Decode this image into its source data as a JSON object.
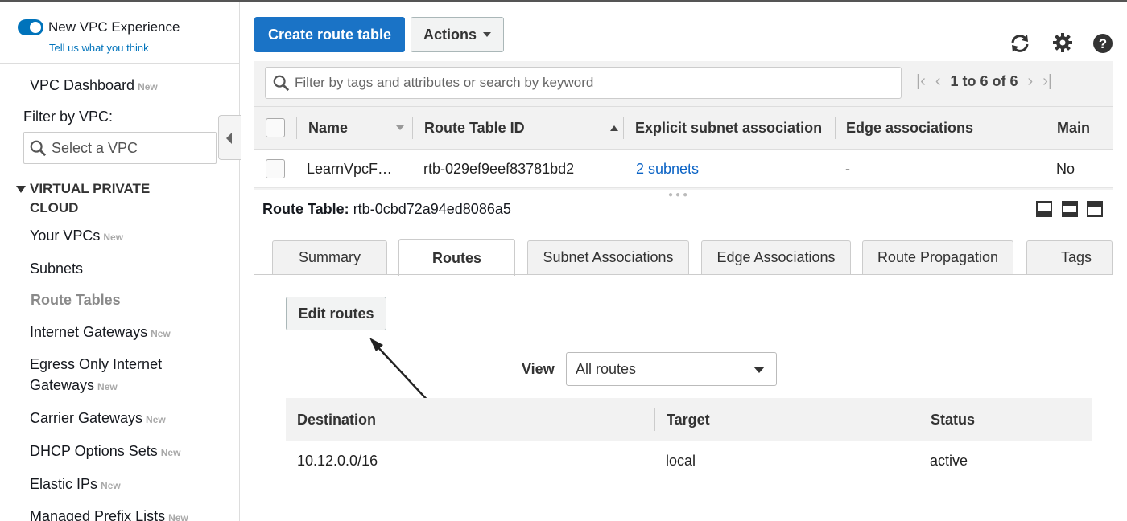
{
  "sidebar": {
    "toggle_label": "New VPC Experience",
    "tell_us": "Tell us what you think",
    "dashboard": "VPC Dashboard",
    "new_badge": "New",
    "filter_label": "Filter by VPC:",
    "select_placeholder": "Select a VPC",
    "section": {
      "line1": "VIRTUAL PRIVATE",
      "line2": "CLOUD"
    },
    "items": [
      {
        "label": "Your VPCs",
        "badge": "New"
      },
      {
        "label": "Subnets",
        "badge": ""
      },
      {
        "label": "Route Tables",
        "badge": ""
      },
      {
        "label": "Internet Gateways",
        "badge": "New"
      },
      {
        "label_line1": "Egress Only Internet",
        "label_line2": "Gateways",
        "badge": "New"
      },
      {
        "label": "Carrier Gateways",
        "badge": "New"
      },
      {
        "label": "DHCP Options Sets",
        "badge": "New"
      },
      {
        "label": "Elastic IPs",
        "badge": "New"
      },
      {
        "label": "Managed Prefix Lists",
        "badge": "New"
      }
    ]
  },
  "toolbar": {
    "create_label": "Create route table",
    "actions_label": "Actions"
  },
  "list": {
    "filter_placeholder": "Filter by tags and attributes or search by keyword",
    "pager_text": "1 to 6 of 6",
    "columns": [
      "Name",
      "Route Table ID",
      "Explicit subnet association",
      "Edge associations",
      "Main"
    ],
    "rows": [
      {
        "name": "LearnVpcF…",
        "id": "rtb-029ef9eef83781bd2",
        "subnet": "2 subnets",
        "edge": "-",
        "main": "No"
      }
    ]
  },
  "detail": {
    "title_label": "Route Table:",
    "title_value": "rtb-0cbd72a94ed8086a5",
    "tabs": [
      "Summary",
      "Routes",
      "Subnet Associations",
      "Edge Associations",
      "Route Propagation",
      "Tags"
    ],
    "edit_label": "Edit routes",
    "view_label": "View",
    "view_value": "All routes",
    "route_columns": [
      "Destination",
      "Target",
      "Status"
    ],
    "routes": [
      {
        "destination": "10.12.0.0/16",
        "target": "local",
        "status": "active"
      }
    ]
  },
  "colors": {
    "primary": "#1a73c6",
    "toggle": "#0073bb",
    "link": "#0b63c5"
  }
}
